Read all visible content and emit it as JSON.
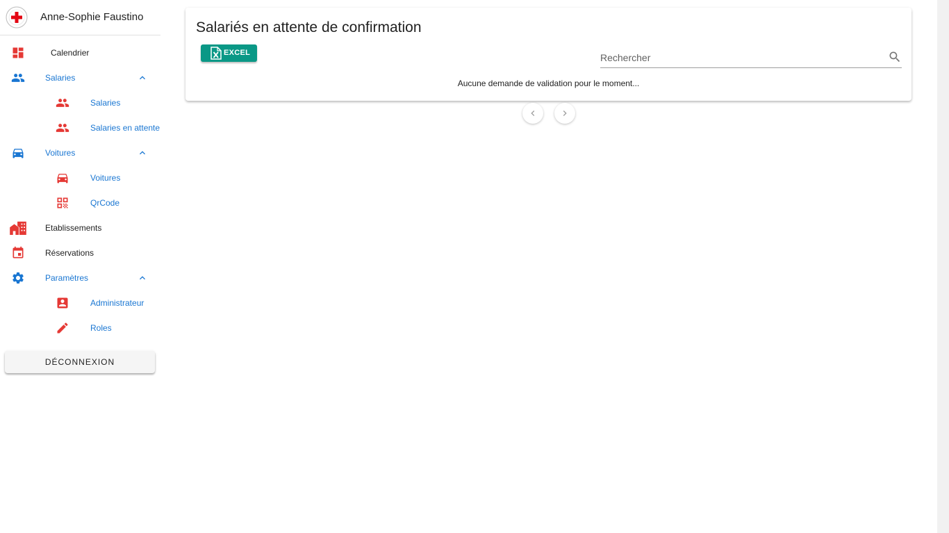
{
  "sidebar": {
    "user_name": "Anne-Sophie Faustino",
    "items": [
      {
        "label": "Calendrier",
        "icon": "dashboard-icon"
      },
      {
        "label": "Salaries",
        "icon": "people-icon",
        "expanded": true
      },
      {
        "label": "Salaries",
        "icon": "people-icon"
      },
      {
        "label": "Salaries en attente",
        "icon": "people-icon"
      },
      {
        "label": "Voitures",
        "icon": "car-icon",
        "expanded": true
      },
      {
        "label": "Voitures",
        "icon": "car-icon"
      },
      {
        "label": "QrCode",
        "icon": "qrcode-icon"
      },
      {
        "label": "Etablissements",
        "icon": "buildings-icon"
      },
      {
        "label": "Réservations",
        "icon": "calendar-icon"
      },
      {
        "label": "Paramètres",
        "icon": "gear-icon",
        "expanded": true
      },
      {
        "label": "Administrateur",
        "icon": "account-box-icon"
      },
      {
        "label": "Roles",
        "icon": "pencil-icon"
      }
    ],
    "logout_label": "DÉCONNEXION"
  },
  "main": {
    "title": "Salariés en attente de confirmation",
    "excel_label": "EXCEL",
    "search_placeholder": "Rechercher",
    "search_value": "",
    "empty_message": "Aucune demande de validation pour le moment..."
  },
  "colors": {
    "red_icon": "#e53935",
    "blue_icon": "#1976d2",
    "excel_green": "#0a9886",
    "link_blue": "#1976d2"
  }
}
